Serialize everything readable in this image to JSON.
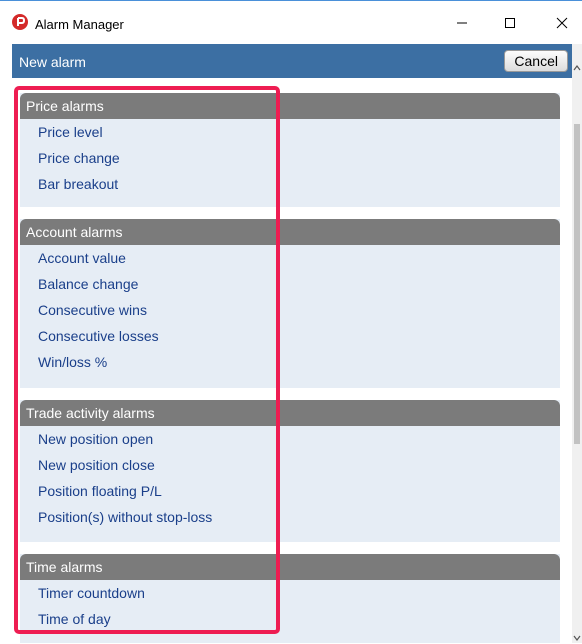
{
  "window": {
    "title": "Alarm Manager",
    "icons": {
      "logo": "app-logo-icon",
      "minimize": "minimize-icon",
      "maximize": "maximize-icon",
      "close": "close-icon"
    }
  },
  "toolbar": {
    "title": "New alarm",
    "cancel_label": "Cancel"
  },
  "colors": {
    "toolbar_bg": "#3c6fa3",
    "section_header_bg": "#7b7b7b",
    "section_bg": "#e6edf5",
    "link_text": "#1a3f8a",
    "highlight_border": "#ee1d52"
  },
  "sections": [
    {
      "title": "Price alarms",
      "items": [
        "Price level",
        "Price change",
        "Bar breakout"
      ]
    },
    {
      "title": "Account alarms",
      "items": [
        "Account value",
        "Balance change",
        "Consecutive wins",
        "Consecutive losses",
        "Win/loss %"
      ]
    },
    {
      "title": "Trade activity alarms",
      "items": [
        "New position open",
        "New position close",
        "Position floating P/L",
        "Position(s) without stop-loss"
      ]
    },
    {
      "title": "Time alarms",
      "items": [
        "Timer countdown",
        "Time of day"
      ]
    }
  ]
}
